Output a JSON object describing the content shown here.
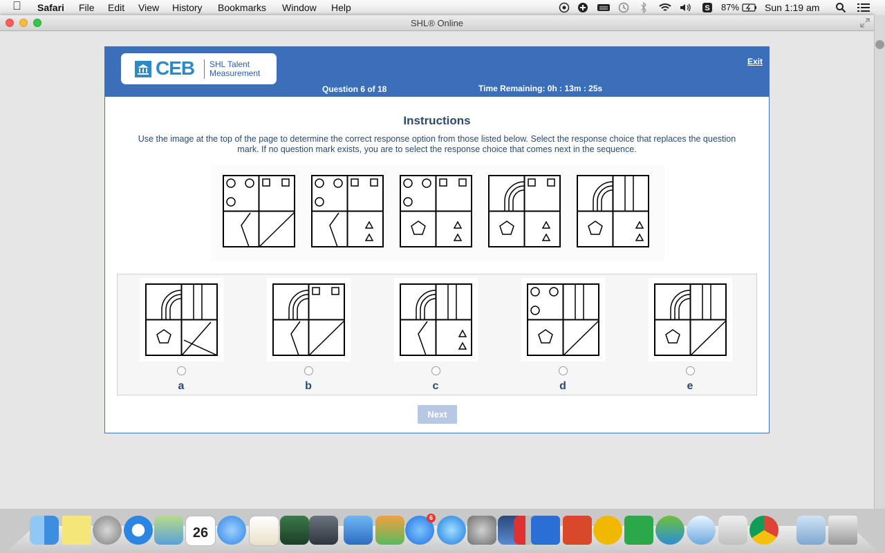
{
  "menubar": {
    "app_name": "Safari",
    "items": [
      "File",
      "Edit",
      "View",
      "History",
      "Bookmarks",
      "Window",
      "Help"
    ],
    "battery": "87%",
    "clock": "Sun 1:19 am"
  },
  "window": {
    "title": "SHL® Online"
  },
  "header": {
    "logo_ceb": "CEB",
    "logo_sub": "SHL Talent Measurement",
    "exit": "Exit",
    "question": "Question 6 of 18",
    "time_remaining": "Time Remaining: 0h : 13m : 25s"
  },
  "content": {
    "title": "Instructions",
    "text": "Use the image at the top of the page to determine the correct response option from those listed below. Select the response choice that replaces the question mark. If no question mark exists, you are to select the response choice that comes next in the sequence."
  },
  "options": [
    {
      "letter": "a"
    },
    {
      "letter": "b"
    },
    {
      "letter": "c"
    },
    {
      "letter": "d"
    },
    {
      "letter": "e"
    }
  ],
  "next_button": "Next",
  "colors": {
    "header_blue": "#3b6fba",
    "text_navy": "#2b4a6e",
    "next_disabled": "#b8c8e2"
  },
  "dock_icons": [
    "finder",
    "notes",
    "launchpad",
    "safari",
    "preview",
    "calendar",
    "messages",
    "textedit",
    "iphoto",
    "facetime",
    "keynote",
    "numbers",
    "app-store",
    "itunes",
    "system-preferences",
    "photo-booth",
    "parallels",
    "word",
    "powerpoint",
    "outlook",
    "excel",
    "messenger",
    "preview-2",
    "contacts",
    "chrome",
    "downloads",
    "trash"
  ],
  "dock_calendar_day": "26",
  "dock_appstore_badge": "6"
}
